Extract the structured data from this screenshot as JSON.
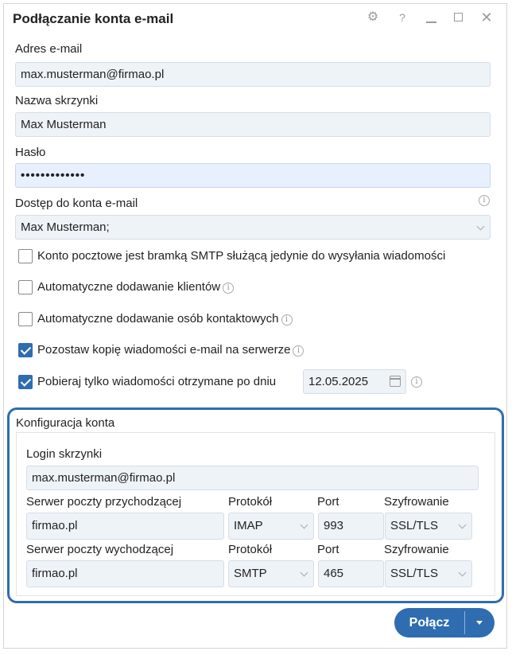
{
  "window": {
    "title": "Podłączanie konta e-mail",
    "controls": [
      "gear-icon",
      "help-icon",
      "minimize-icon",
      "maximize-icon",
      "close-icon"
    ]
  },
  "form": {
    "email_label": "Adres e-mail",
    "email_value": "max.musterman@firmao.pl",
    "mailbox_name_label": "Nazwa skrzynki",
    "mailbox_name_value": "Max Musterman",
    "password_label": "Hasło",
    "password_value": "•••••••••••••",
    "access_label": "Dostęp do konta e-mail",
    "access_value": "Max Musterman;"
  },
  "options": {
    "smtp_gateway": {
      "label": "Konto pocztowe jest bramką SMTP służącą jedynie do wysyłania wiadomości",
      "checked": false
    },
    "auto_clients": {
      "label": "Automatyczne dodawanie klientów",
      "checked": false
    },
    "auto_contacts": {
      "label": "Automatyczne dodawanie osób kontaktowych",
      "checked": false
    },
    "keep_copy": {
      "label": "Pozostaw kopię wiadomości e-mail na serwerze",
      "checked": true
    },
    "fetch_after": {
      "label": "Pobieraj tylko wiadomości otrzymane po dniu",
      "checked": true,
      "date": "12.05.2025"
    }
  },
  "config": {
    "section_title": "Konfiguracja konta",
    "login_label": "Login skrzynki",
    "login_value": "max.musterman@firmao.pl",
    "incoming": {
      "server_label": "Serwer poczty przychodzącej",
      "server_value": "firmao.pl",
      "protocol_label": "Protokół",
      "protocol_value": "IMAP",
      "port_label": "Port",
      "port_value": "993",
      "encryption_label": "Szyfrowanie",
      "encryption_value": "SSL/TLS"
    },
    "outgoing": {
      "server_label": "Serwer poczty wychodzącej",
      "server_value": "firmao.pl",
      "protocol_label": "Protokół",
      "protocol_value": "SMTP",
      "port_label": "Port",
      "port_value": "465",
      "encryption_label": "Szyfrowanie",
      "encryption_value": "SSL/TLS"
    }
  },
  "actions": {
    "connect_label": "Połącz"
  },
  "colors": {
    "accent": "#2f6db0",
    "field_bg": "#eef3f8"
  }
}
